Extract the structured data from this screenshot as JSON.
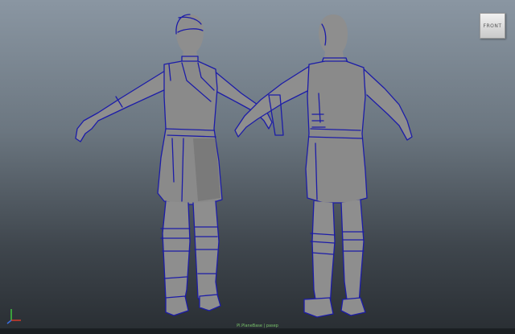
{
  "viewport": {
    "view_cube_label": "FRONT",
    "camera_label": "Pl.PlaneBase | pasep"
  },
  "axis": {
    "x_color": "#d23a2c",
    "y_color": "#3ec43e",
    "z_color": "#3a6ee0"
  },
  "colors": {
    "wireframe_outline": "#1c1ca8",
    "mesh_gray": "#8e8e8e",
    "camera_label": "#79c26a"
  }
}
